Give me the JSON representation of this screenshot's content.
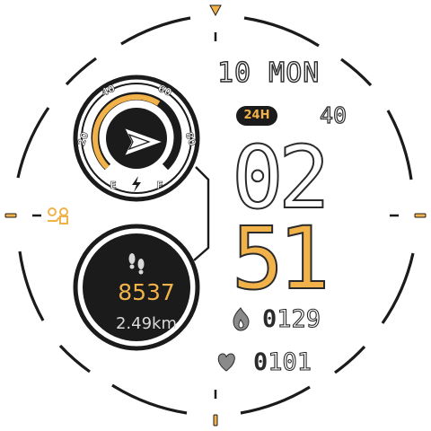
{
  "date": {
    "text": "10 MON"
  },
  "time": {
    "format_badge": "24H",
    "hour": "02",
    "minute": "51",
    "seconds": "40"
  },
  "gauge": {
    "tick_labels": [
      "20",
      "40",
      "60",
      "80"
    ],
    "empty_label": "E",
    "full_label": "F",
    "level_fraction": 0.62
  },
  "steps": {
    "value": "8537",
    "distance": "2.49km"
  },
  "calories": {
    "lead_digit": "0",
    "rest": "129"
  },
  "heart_rate": {
    "lead_digit": "0",
    "rest": "101"
  },
  "icons": {
    "dial_marker": "triangle-marker-icon",
    "gauge_needle": "arrow-needle-icon",
    "charge": "lightning-bolt-icon",
    "footsteps": "footsteps-icon",
    "flame": "flame-icon",
    "heart": "heart-icon",
    "app_shortcut": "shortcut-icon"
  },
  "colors": {
    "accent": "#f2b24a",
    "dark": "#1b1b1b",
    "outline": "#2b2b2b",
    "background": "#ffffff"
  }
}
